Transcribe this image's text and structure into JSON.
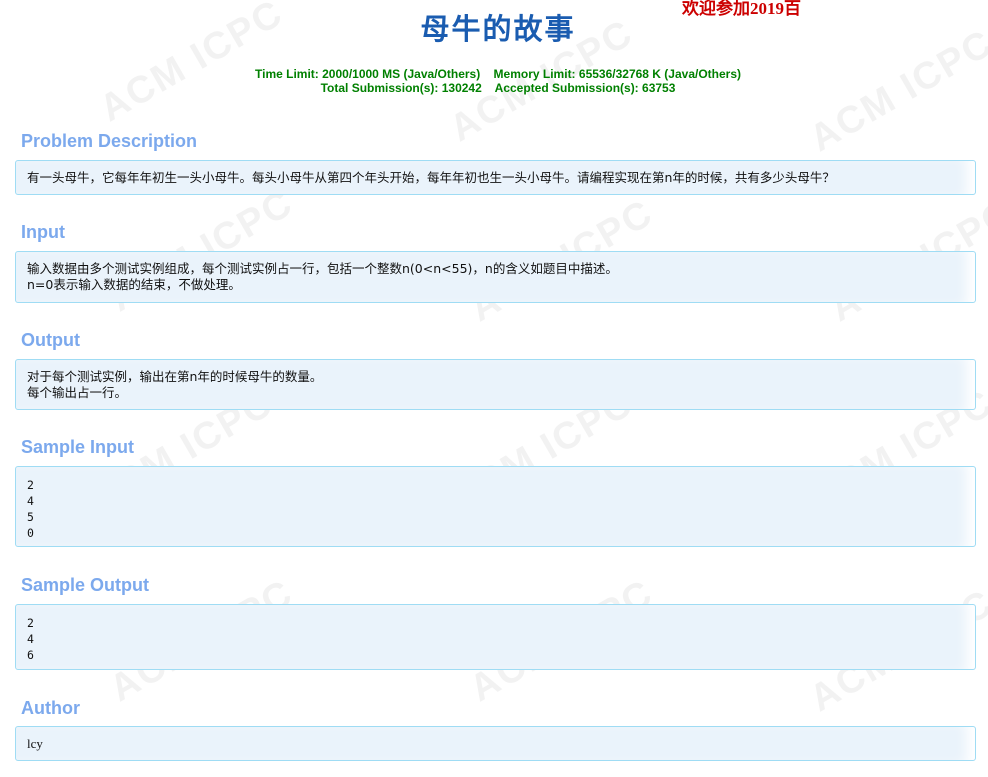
{
  "header": {
    "notice": "欢迎参加2019百",
    "title": "母牛的故事",
    "limits_line1": "Time Limit: 2000/1000 MS (Java/Others)    Memory Limit: 65536/32768 K (Java/Others)",
    "limits_line2": "Total Submission(s): 130242    Accepted Submission(s): 63753"
  },
  "watermark_text": "ACM ICPC",
  "sections": {
    "description": {
      "title": "Problem Description",
      "lines": [
        "有一头母牛，它每年年初生一头小母牛。每头小母牛从第四个年头开始，每年年初也生一头小母牛。请编程实现在第n年的时候，共有多少头母牛？"
      ]
    },
    "input": {
      "title": "Input",
      "lines": [
        "输入数据由多个测试实例组成，每个测试实例占一行，包括一个整数n(0<n<55)，n的含义如题目中描述。",
        "n=0表示输入数据的结束，不做处理。"
      ]
    },
    "output": {
      "title": "Output",
      "lines": [
        "对于每个测试实例，输出在第n年的时候母牛的数量。",
        "每个输出占一行。"
      ]
    },
    "sample_input": {
      "title": "Sample Input",
      "lines": [
        "2",
        "4",
        "5",
        "0"
      ]
    },
    "sample_output": {
      "title": "Sample Output",
      "lines": [
        "2",
        "4",
        "6"
      ]
    },
    "author": {
      "title": "Author",
      "lines": [
        "lcy"
      ]
    }
  }
}
